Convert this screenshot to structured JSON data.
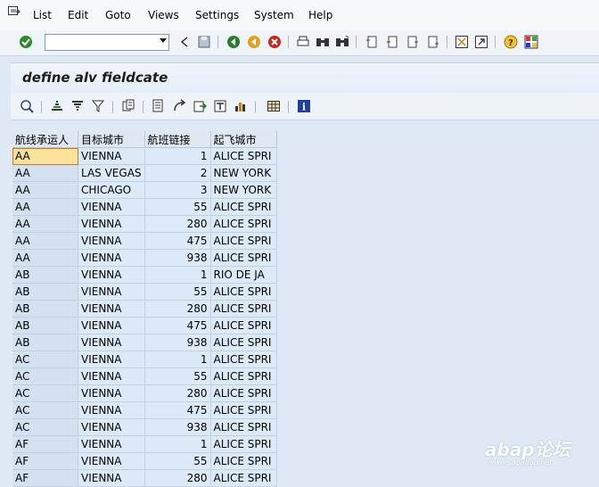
{
  "menu": {
    "items": [
      {
        "label": "List"
      },
      {
        "label": "Edit"
      },
      {
        "label": "Goto"
      },
      {
        "label": "Views"
      },
      {
        "label": "Settings"
      },
      {
        "label": "System"
      },
      {
        "label": "Help"
      }
    ]
  },
  "std_toolbar": {
    "command_field_value": "",
    "icons": [
      "enter-check-icon",
      "back-icon",
      "exit-icon",
      "cancel-icon",
      "print-icon",
      "find-icon",
      "find-next-icon",
      "first-page-icon",
      "previous-page-icon",
      "next-page-icon",
      "last-page-icon",
      "create-session-icon",
      "shortcut-icon",
      "help-icon",
      "layout-menu-icon"
    ]
  },
  "title": "define alv fieldcate",
  "app_toolbar": {
    "icons": [
      "details-icon",
      "sort-ascending-icon",
      "sort-descending-icon",
      "filter-icon",
      "total-icon",
      "print-preview-icon",
      "export-icon",
      "send-icon",
      "abc-analysis-icon",
      "graphic-icon",
      "change-layout-icon",
      "information-icon"
    ]
  },
  "grid": {
    "columns": [
      "航线承运人",
      "目标城市",
      "航班链接",
      "起飞城市"
    ],
    "rows": [
      [
        "AA",
        "VIENNA",
        "1",
        "ALICE SPRI"
      ],
      [
        "AA",
        "LAS VEGAS",
        "2",
        "NEW YORK"
      ],
      [
        "AA",
        "CHICAGO",
        "3",
        "NEW YORK"
      ],
      [
        "AA",
        "VIENNA",
        "55",
        "ALICE SPRI"
      ],
      [
        "AA",
        "VIENNA",
        "280",
        "ALICE SPRI"
      ],
      [
        "AA",
        "VIENNA",
        "475",
        "ALICE SPRI"
      ],
      [
        "AA",
        "VIENNA",
        "938",
        "ALICE SPRI"
      ],
      [
        "AB",
        "VIENNA",
        "1",
        "RIO DE JA"
      ],
      [
        "AB",
        "VIENNA",
        "55",
        "ALICE SPRI"
      ],
      [
        "AB",
        "VIENNA",
        "280",
        "ALICE SPRI"
      ],
      [
        "AB",
        "VIENNA",
        "475",
        "ALICE SPRI"
      ],
      [
        "AB",
        "VIENNA",
        "938",
        "ALICE SPRI"
      ],
      [
        "AC",
        "VIENNA",
        "1",
        "ALICE SPRI"
      ],
      [
        "AC",
        "VIENNA",
        "55",
        "ALICE SPRI"
      ],
      [
        "AC",
        "VIENNA",
        "280",
        "ALICE SPRI"
      ],
      [
        "AC",
        "VIENNA",
        "475",
        "ALICE SPRI"
      ],
      [
        "AC",
        "VIENNA",
        "938",
        "ALICE SPRI"
      ],
      [
        "AF",
        "VIENNA",
        "1",
        "ALICE SPRI"
      ],
      [
        "AF",
        "VIENNA",
        "55",
        "ALICE SPRI"
      ],
      [
        "AF",
        "VIENNA",
        "280",
        "ALICE SPRI"
      ]
    ]
  },
  "watermark": {
    "big": "abap论坛",
    "small": "www.sapabap.net"
  }
}
